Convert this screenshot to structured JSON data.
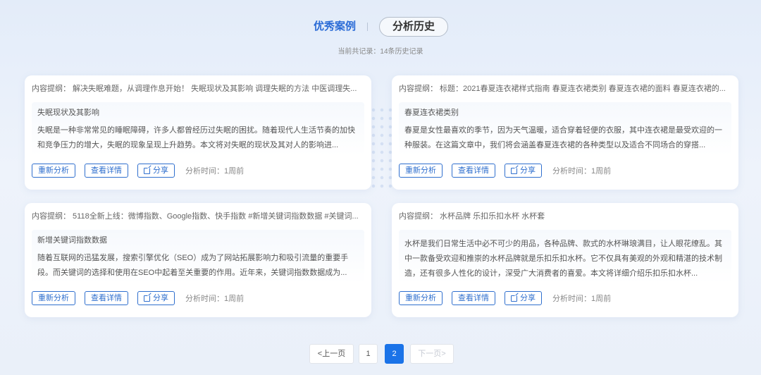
{
  "tabs": {
    "cases_label": "优秀案例",
    "history_label": "分析历史"
  },
  "record_count": "当前共记录：14条历史记录",
  "cards": [
    {
      "head": "内容提纲：  解决失眠难题，从调理作息开始！ 失眠现状及其影响 调理失眠的方法 中医调理失...",
      "title": "失眠现状及其影响",
      "text": "失眠是一种非常常见的睡眠障碍，许多人都曾经历过失眠的困扰。随着现代人生活节奏的加快和竞争压力的增大，失眠的现象呈现上升趋势。本文将对失眠的现状及其对人的影响进...",
      "reanalyze": "重新分析",
      "details": "查看详情",
      "share": "分享",
      "time": "分析时间：1周前"
    },
    {
      "head": "内容提纲：  标题：2021春夏连衣裙样式指南 春夏连衣裙类别 春夏连衣裙的面料 春夏连衣裙的...",
      "title": "春夏连衣裙类别",
      "text": "春夏是女性最喜欢的季节，因为天气温暖，适合穿着轻便的衣服，其中连衣裙是最受欢迎的一种服装。在这篇文章中，我们将会涵盖春夏连衣裙的各种类型以及适合不同场合的穿搭...",
      "reanalyze": "重新分析",
      "details": "查看详情",
      "share": "分享",
      "time": "分析时间：1周前"
    },
    {
      "head": "内容提纲：  5118全新上线：微博指数、Google指数、快手指数 #新增关键词指数数据 #关键词...",
      "title": "新增关键词指数数据",
      "text": "随着互联网的迅猛发展，搜索引擎优化（SEO）成为了网站拓展影响力和吸引流量的重要手段。而关键词的选择和使用在SEO中起着至关重要的作用。近年来，关键词指数数据成为...",
      "reanalyze": "重新分析",
      "details": "查看详情",
      "share": "分享",
      "time": "分析时间：1周前"
    },
    {
      "head": "内容提纲：  水杯品牌 乐扣乐扣水杯 水杯套",
      "title": "",
      "text": "水杯是我们日常生活中必不可少的用品，各种品牌、款式的水杯琳琅满目，让人眼花缭乱。其中一款备受欢迎和推崇的水杯品牌就是乐扣乐扣水杯。它不仅具有美观的外观和精湛的技术制造，还有很多人性化的设计，深受广大消费者的喜爱。本文将详细介绍乐扣乐扣水杯...",
      "reanalyze": "重新分析",
      "details": "查看详情",
      "share": "分享",
      "time": "分析时间：1周前"
    }
  ],
  "pagination": {
    "prev": "<上一页",
    "page1": "1",
    "page2": "2",
    "next": "下一页>"
  }
}
